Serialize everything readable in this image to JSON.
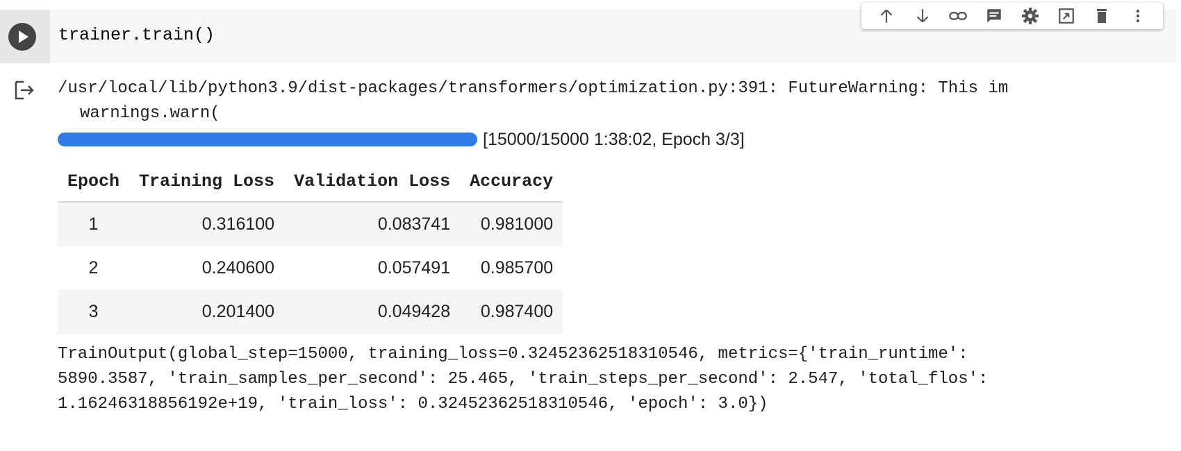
{
  "cell": {
    "code": "trainer.train()",
    "run_button_icon": "play-icon",
    "toolbar_icons": [
      "arrow-up-icon",
      "arrow-down-icon",
      "link-icon",
      "comment-icon",
      "gear-icon",
      "mirror-cell-icon",
      "delete-icon",
      "more-vert-icon"
    ]
  },
  "output": {
    "icon": "output-icon",
    "warning_line1": "/usr/local/lib/python3.9/dist-packages/transformers/optimization.py:391: FutureWarning: This im",
    "warning_line2": "warnings.warn(",
    "progress": {
      "fraction": 1.0,
      "label": "[15000/15000 1:38:02, Epoch 3/3]"
    },
    "table": {
      "columns": [
        "Epoch",
        "Training Loss",
        "Validation Loss",
        "Accuracy"
      ],
      "rows": [
        [
          "1",
          "0.316100",
          "0.083741",
          "0.981000"
        ],
        [
          "2",
          "0.240600",
          "0.057491",
          "0.985700"
        ],
        [
          "3",
          "0.201400",
          "0.049428",
          "0.987400"
        ]
      ]
    },
    "summary_lines": [
      "TrainOutput(global_step=15000, training_loss=0.32452362518310546, metrics={'train_runtime':",
      "5890.3587, 'train_samples_per_second': 25.465, 'train_steps_per_second': 2.547, 'total_flos':",
      "1.16246318856192e+19, 'train_loss': 0.32452362518310546, 'epoch': 3.0})"
    ]
  },
  "colors": {
    "progress_fill": "#2f7be8",
    "run_button": "#444444"
  }
}
